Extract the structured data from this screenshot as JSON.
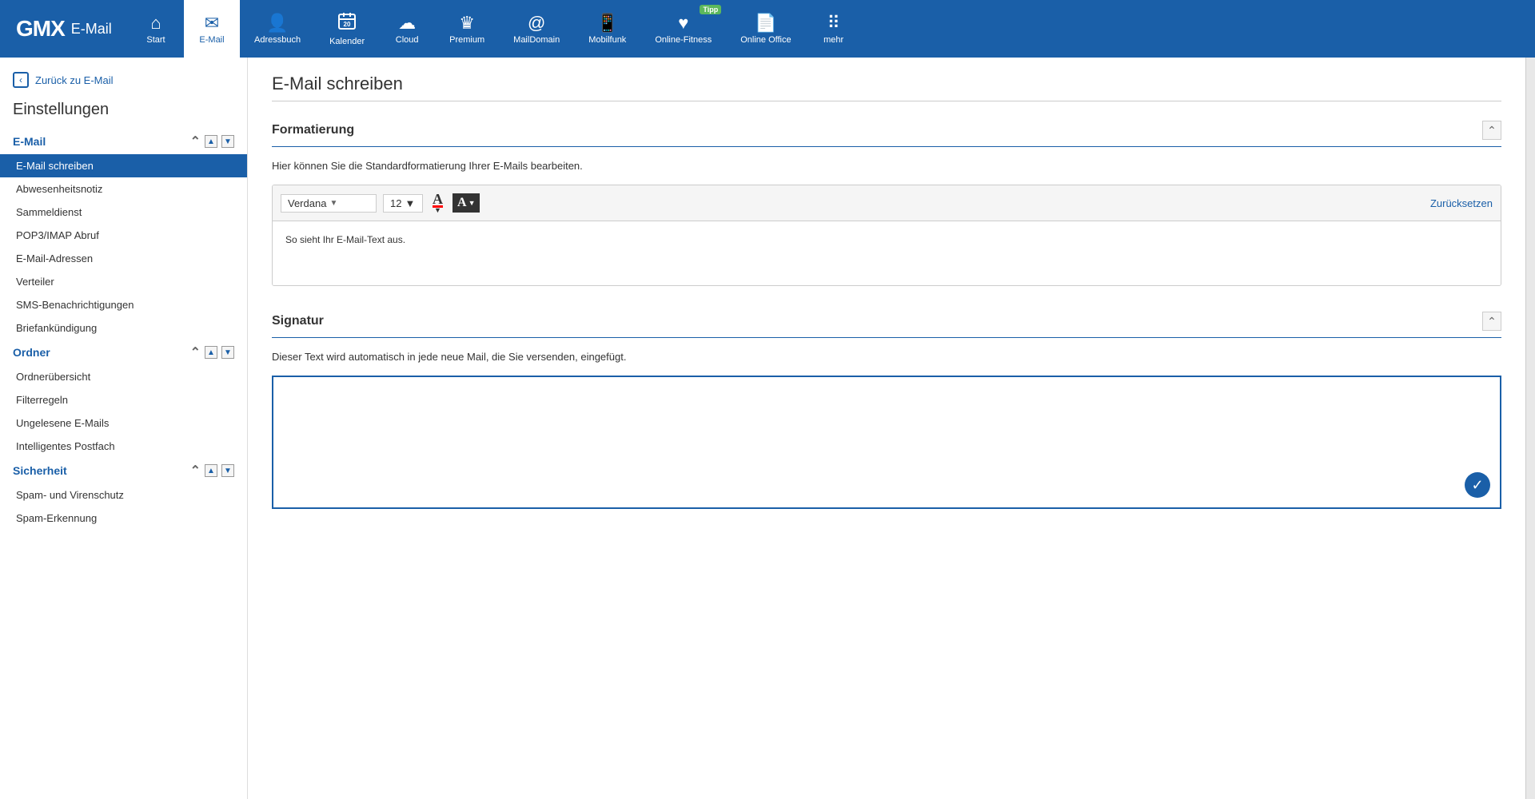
{
  "logo": {
    "gmx": "GMX",
    "email": "E-Mail"
  },
  "nav": {
    "items": [
      {
        "id": "start",
        "label": "Start",
        "icon": "⌂",
        "active": false
      },
      {
        "id": "email",
        "label": "E-Mail",
        "icon": "✉",
        "active": true
      },
      {
        "id": "adressbuch",
        "label": "Adressbuch",
        "icon": "👤",
        "active": false
      },
      {
        "id": "kalender",
        "label": "Kalender",
        "icon": "📅",
        "active": false,
        "badge": "20"
      },
      {
        "id": "cloud",
        "label": "Cloud",
        "icon": "☁",
        "active": false
      },
      {
        "id": "premium",
        "label": "Premium",
        "icon": "♛",
        "active": false
      },
      {
        "id": "maildomain",
        "label": "MailDomain",
        "icon": "✉",
        "active": false
      },
      {
        "id": "mobilfunk",
        "label": "Mobilfunk",
        "icon": "📱",
        "active": false
      },
      {
        "id": "online-fitness",
        "label": "Online-Fitness",
        "icon": "♥",
        "active": false,
        "tipp": "Tipp"
      },
      {
        "id": "online-office",
        "label": "Online Office",
        "icon": "📄",
        "active": false
      },
      {
        "id": "mehr",
        "label": "mehr",
        "icon": "⠿",
        "active": false
      }
    ]
  },
  "sidebar": {
    "back_label": "Zurück zu E-Mail",
    "title": "Einstellungen",
    "sections": [
      {
        "id": "email",
        "label": "E-Mail",
        "items": [
          {
            "id": "email-schreiben",
            "label": "E-Mail schreiben",
            "active": true
          },
          {
            "id": "abwesenheitsnotiz",
            "label": "Abwesenheitsnotiz",
            "active": false
          },
          {
            "id": "sammeldienst",
            "label": "Sammeldienst",
            "active": false
          },
          {
            "id": "pop3-imap",
            "label": "POP3/IMAP Abruf",
            "active": false
          },
          {
            "id": "email-adressen",
            "label": "E-Mail-Adressen",
            "active": false
          },
          {
            "id": "verteiler",
            "label": "Verteiler",
            "active": false
          },
          {
            "id": "sms-benachrichtigungen",
            "label": "SMS-Benachrichtigungen",
            "active": false
          },
          {
            "id": "briefankuendigung",
            "label": "Briefankündigung",
            "active": false
          }
        ]
      },
      {
        "id": "ordner",
        "label": "Ordner",
        "items": [
          {
            "id": "ordneruebersicht",
            "label": "Ordnerübersicht",
            "active": false
          },
          {
            "id": "filterregeln",
            "label": "Filterregeln",
            "active": false
          },
          {
            "id": "ungelesene-emails",
            "label": "Ungelesene E-Mails",
            "active": false
          },
          {
            "id": "intelligentes-postfach",
            "label": "Intelligentes Postfach",
            "active": false
          }
        ]
      },
      {
        "id": "sicherheit",
        "label": "Sicherheit",
        "items": [
          {
            "id": "spam-virenschutz",
            "label": "Spam- und Virenschutz",
            "active": false
          },
          {
            "id": "spam-erkennung",
            "label": "Spam-Erkennung",
            "active": false
          }
        ]
      }
    ]
  },
  "content": {
    "page_title": "E-Mail schreiben",
    "sections": [
      {
        "id": "formatierung",
        "title": "Formatierung",
        "description": "Hier können Sie die Standardformatierung Ihrer E-Mails bearbeiten.",
        "font": "Verdana",
        "font_size": "12",
        "reset_label": "Zurücksetzen",
        "preview_text": "So sieht Ihr E-Mail-Text aus."
      },
      {
        "id": "signatur",
        "title": "Signatur",
        "description": "Dieser Text wird automatisch in jede neue Mail, die Sie versenden, eingefügt."
      }
    ]
  }
}
